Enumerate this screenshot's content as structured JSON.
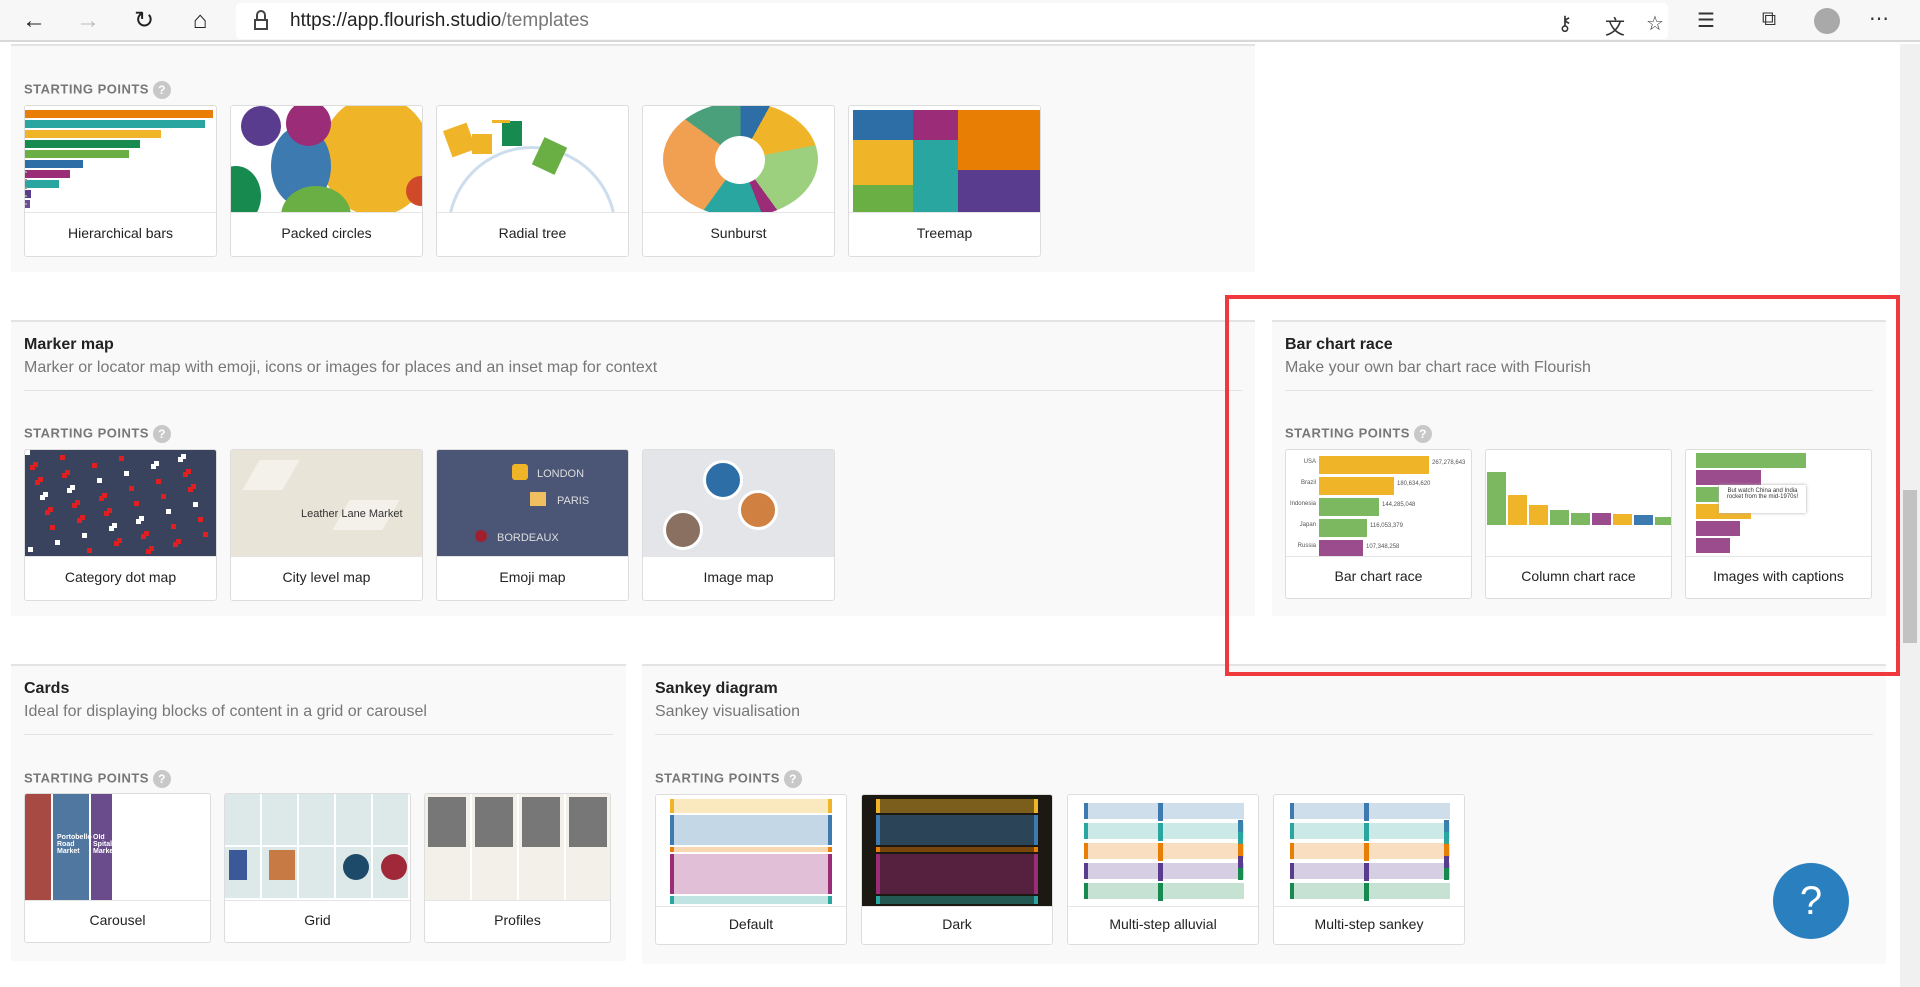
{
  "browser": {
    "url_host": "https://app.flourish.studio",
    "url_path": "/templates",
    "icons": [
      "back-icon",
      "forward-icon",
      "refresh-icon",
      "home-icon",
      "lock-icon",
      "key-icon",
      "translate-icon",
      "favorite-star-icon",
      "favorites-list-icon",
      "collections-icon",
      "profile-avatar",
      "more-icon"
    ]
  },
  "starting_points_label": "STARTING POINTS",
  "help_glyph": "?",
  "sections": [
    {
      "id": "hierarchy",
      "title": "",
      "subtitle": "",
      "cards": [
        {
          "label": "Hierarchical bars",
          "thumb": "hbars"
        },
        {
          "label": "Packed circles",
          "thumb": "packed"
        },
        {
          "label": "Radial tree",
          "thumb": "radial"
        },
        {
          "label": "Sunburst",
          "thumb": "sunburst"
        },
        {
          "label": "Treemap",
          "thumb": "treemap"
        }
      ]
    },
    {
      "id": "marker",
      "title": "Marker map",
      "subtitle": "Marker or locator map with emoji, icons or images for places and an inset map for context",
      "cards": [
        {
          "label": "Category dot map",
          "thumb": "dotmap"
        },
        {
          "label": "City level map",
          "thumb": "citymap",
          "text": [
            "Leather Lane Market"
          ]
        },
        {
          "label": "Emoji map",
          "thumb": "emojimap",
          "text": [
            "LONDON",
            "PARIS",
            "BORDEAUX"
          ]
        },
        {
          "label": "Image map",
          "thumb": "imagemap"
        }
      ]
    },
    {
      "id": "barrace",
      "title": "Bar chart race",
      "subtitle": "Make your own bar chart race with Flourish",
      "cards": [
        {
          "label": "Bar chart race",
          "thumb": "barrace",
          "text": [
            "USA",
            "Brazil",
            "Indonesia",
            "Japan",
            "Russia"
          ],
          "values": [
            "267,278,643",
            "180,634,620",
            "144,285,048",
            "116,053,379",
            "107,348,258"
          ]
        },
        {
          "label": "Column chart race",
          "thumb": "colrace"
        },
        {
          "label": "Images with captions",
          "thumb": "captions",
          "text": [
            "But watch China and India rocket from the mid-1970s!"
          ]
        }
      ]
    },
    {
      "id": "cards",
      "title": "Cards",
      "subtitle": "Ideal for displaying blocks of content in a grid or carousel",
      "cards": [
        {
          "label": "Carousel",
          "thumb": "carousel",
          "text": [
            "Portobello Road Market",
            "Old Spitalfields Market"
          ]
        },
        {
          "label": "Grid",
          "thumb": "grid"
        },
        {
          "label": "Profiles",
          "thumb": "profiles"
        }
      ]
    },
    {
      "id": "sankey",
      "title": "Sankey diagram",
      "subtitle": "Sankey visualisation",
      "cards": [
        {
          "label": "Default",
          "thumb": "sankey"
        },
        {
          "label": "Dark",
          "thumb": "sankeydark"
        },
        {
          "label": "Multi-step alluvial",
          "thumb": "alluvial"
        },
        {
          "label": "Multi-step sankey",
          "thumb": "multisankey"
        }
      ]
    }
  ],
  "highlight_color": "#f0393c",
  "help_button_color": "#2a80bf"
}
